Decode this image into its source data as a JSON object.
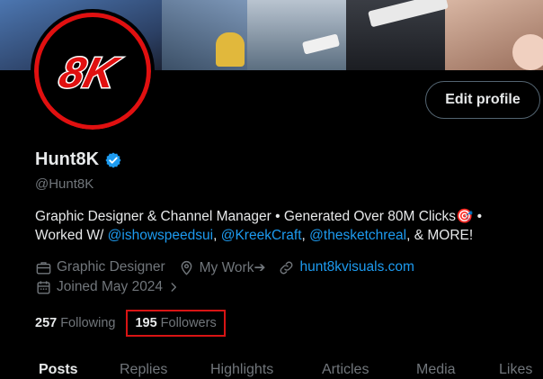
{
  "profile": {
    "display_name": "Hunt8K",
    "handle": "@Hunt8K",
    "verified": true,
    "avatar_text": "8K",
    "edit_button_label": "Edit profile"
  },
  "bio": {
    "line1": "Graphic Designer & Channel Manager • Generated Over 80M Clicks",
    "line1_emoji": "🎯",
    "line1_suffix": " •",
    "line2_prefix": "Worked W/ ",
    "mentions": [
      "@ishowspeedsui",
      "@KreekCraft",
      "@thesketchreal"
    ],
    "line2_suffix": ", & MORE!"
  },
  "meta": {
    "category": "Graphic Designer",
    "location": "My Work➔",
    "website": "hunt8kvisuals.com",
    "joined": "Joined May 2024"
  },
  "stats": {
    "following_count": "257",
    "following_label": "Following",
    "followers_count": "195",
    "followers_label": "Followers"
  },
  "tabs": [
    "Posts",
    "Replies",
    "Highlights",
    "Articles",
    "Media",
    "Likes"
  ],
  "colors": {
    "accent": "#1d9bf0",
    "highlight_box": "#d81414",
    "avatar_ring": "#e11010"
  },
  "icons": {
    "verified": "verified-badge-icon",
    "category": "briefcase-icon",
    "location": "location-pin-icon",
    "website": "link-icon",
    "joined": "calendar-icon"
  }
}
